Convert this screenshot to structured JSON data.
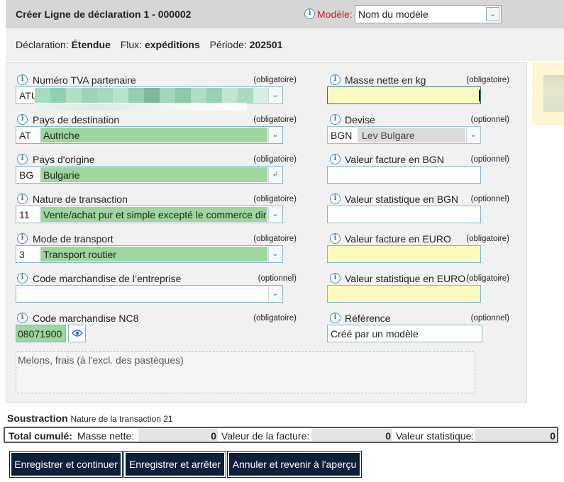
{
  "header": {
    "title": "Créer Ligne de déclaration 1 - 000002",
    "modele_label": "Modèle:",
    "modele_value": "Nom du modèle"
  },
  "info": {
    "declaration_label": "Déclaration:",
    "declaration_value": "Étendue",
    "flux_label": "Flux:",
    "flux_value": "expéditions",
    "periode_label": "Période:",
    "periode_value": "202501"
  },
  "left_fields": [
    {
      "label": "Numéro TVA partenaire",
      "req": "(obligatoire)",
      "code": "ATU",
      "value": ""
    },
    {
      "label": "Pays de destination",
      "req": "(obligatoire)",
      "code": "AT",
      "value": "Autriche"
    },
    {
      "label": "Pays d'origine",
      "req": "(obligatoire)",
      "code": "BG",
      "value": "Bulgarie"
    },
    {
      "label": "Nature de transaction",
      "req": "(obligatoire)",
      "code": "11",
      "value": "Vente/achat pur et simple excepté le commerce dire"
    },
    {
      "label": "Mode de transport",
      "req": "(obligatoire)",
      "code": "3",
      "value": "Transport routier"
    },
    {
      "label": "Code marchandise de l’entreprise",
      "req": "(optionnel)",
      "code": "",
      "value": ""
    },
    {
      "label": "Code marchandise NC8",
      "req": "(obligatoire)",
      "code": "08071900",
      "value": ""
    }
  ],
  "right_fields": [
    {
      "label": "Masse nette en kg",
      "req": "(obligatoire)",
      "value": ""
    },
    {
      "label": "Devise",
      "req": "(optionnel)",
      "code": "BGN",
      "value": "Lev Bulgare"
    },
    {
      "label": "Valeur facture en BGN",
      "req": "(optionnel)",
      "value": ""
    },
    {
      "label": "Valeur statistique en BGN",
      "req": "(optionnel)",
      "value": ""
    },
    {
      "label": "Valeur facture en EURO",
      "req": "(obligatoire)",
      "value": ""
    },
    {
      "label": "Valeur statistique en EURO",
      "req": "(obligatoire)",
      "value": ""
    },
    {
      "label": "Référence",
      "req": "(optionnel)",
      "value": "Créé par un modèle"
    }
  ],
  "description": "Melons, frais (à l'excl. des pastèques)",
  "soustraction": {
    "label": "Soustraction",
    "text": "Nature de la transaction 21"
  },
  "totals": {
    "label": "Total cumulé:",
    "masse_label": "Masse nette:",
    "masse_value": "0",
    "facture_label": "Valeur de la facture:",
    "facture_value": "0",
    "stat_label": "Valeur statistique:",
    "stat_value": "0"
  },
  "buttons": {
    "save_continue": "Enregistrer et continuer",
    "save_stop": "Enregistrer et arrêter",
    "cancel": "Annuler et revenir à l'aperçu"
  },
  "icons": {
    "info": "info-icon",
    "dropdown": "chevron-down-icon",
    "eye": "eye-icon",
    "origin": "corner-arrow-icon"
  },
  "colors": {
    "green_fill": "#9ed69e",
    "yellow_required": "#fbfbc0",
    "modele_label": "#d31818",
    "button_dark": "#0e1f3a"
  }
}
